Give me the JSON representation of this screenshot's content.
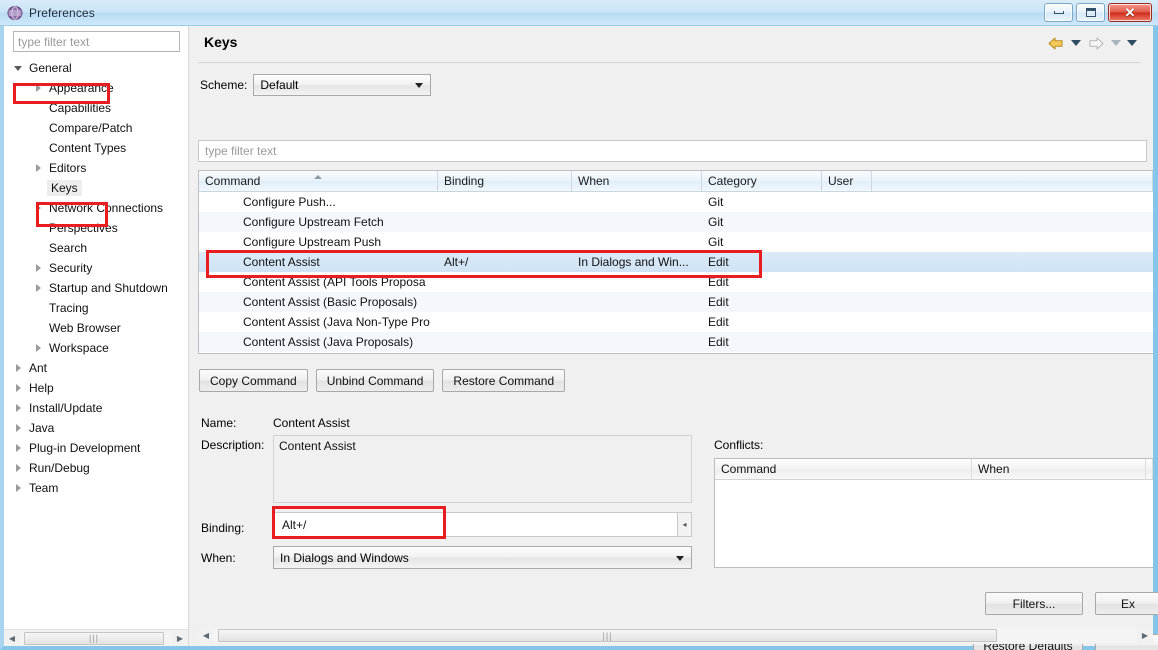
{
  "window": {
    "title": "Preferences",
    "icon": "preferences-icon",
    "buttons": {
      "minimize": "minimize-button",
      "maximize": "maximize-button",
      "close": "✕"
    }
  },
  "sidebar": {
    "filter_placeholder": "type filter text",
    "filter_value": "",
    "items": [
      {
        "label": "General",
        "indent": 0,
        "arrow": "expanded",
        "highlighted": true
      },
      {
        "label": "Appearance",
        "indent": 1,
        "arrow": "collapsed",
        "highlighted": false
      },
      {
        "label": "Capabilities",
        "indent": 1,
        "arrow": "none",
        "highlighted": false
      },
      {
        "label": "Compare/Patch",
        "indent": 1,
        "arrow": "none",
        "highlighted": false
      },
      {
        "label": "Content Types",
        "indent": 1,
        "arrow": "none",
        "highlighted": false
      },
      {
        "label": "Editors",
        "indent": 1,
        "arrow": "collapsed",
        "highlighted": false
      },
      {
        "label": "Keys",
        "indent": 1,
        "arrow": "none",
        "highlighted": true
      },
      {
        "label": "Network Connections",
        "indent": 1,
        "arrow": "collapsed",
        "highlighted": false
      },
      {
        "label": "Perspectives",
        "indent": 1,
        "arrow": "none",
        "highlighted": false
      },
      {
        "label": "Search",
        "indent": 1,
        "arrow": "none",
        "highlighted": false
      },
      {
        "label": "Security",
        "indent": 1,
        "arrow": "collapsed",
        "highlighted": false
      },
      {
        "label": "Startup and Shutdown",
        "indent": 1,
        "arrow": "collapsed",
        "highlighted": false
      },
      {
        "label": "Tracing",
        "indent": 1,
        "arrow": "none",
        "highlighted": false
      },
      {
        "label": "Web Browser",
        "indent": 1,
        "arrow": "none",
        "highlighted": false
      },
      {
        "label": "Workspace",
        "indent": 1,
        "arrow": "collapsed",
        "highlighted": false
      },
      {
        "label": "Ant",
        "indent": 0,
        "arrow": "collapsed",
        "highlighted": false
      },
      {
        "label": "Help",
        "indent": 0,
        "arrow": "collapsed",
        "highlighted": false
      },
      {
        "label": "Install/Update",
        "indent": 0,
        "arrow": "collapsed",
        "highlighted": false
      },
      {
        "label": "Java",
        "indent": 0,
        "arrow": "collapsed",
        "highlighted": false
      },
      {
        "label": "Plug-in Development",
        "indent": 0,
        "arrow": "collapsed",
        "highlighted": false
      },
      {
        "label": "Run/Debug",
        "indent": 0,
        "arrow": "collapsed",
        "highlighted": false
      },
      {
        "label": "Team",
        "indent": 0,
        "arrow": "collapsed",
        "highlighted": false
      }
    ]
  },
  "page": {
    "title": "Keys",
    "nav": {
      "back_icon": "back-arrow-icon",
      "back_menu_icon": "chevron-down-icon",
      "forward_icon": "forward-arrow-icon",
      "forward_menu_icon": "chevron-down-icon",
      "menu_icon": "chevron-down-icon"
    },
    "scheme": {
      "label": "Scheme:",
      "value": "Default"
    },
    "filter_placeholder": "type filter text",
    "filter_value": ""
  },
  "command_table": {
    "columns": [
      "Command",
      "Binding",
      "When",
      "Category",
      "User"
    ],
    "sorted_column": "Command",
    "rows": [
      {
        "command": "Configure Push...",
        "binding": "",
        "when": "",
        "category": "Git",
        "user": ""
      },
      {
        "command": "Configure Upstream Fetch",
        "binding": "",
        "when": "",
        "category": "Git",
        "user": ""
      },
      {
        "command": "Configure Upstream Push",
        "binding": "",
        "when": "",
        "category": "Git",
        "user": ""
      },
      {
        "command": "Content Assist",
        "binding": "Alt+/",
        "when": "In Dialogs and Win...",
        "category": "Edit",
        "user": ""
      },
      {
        "command": "Content Assist (API Tools Proposa",
        "binding": "",
        "when": "",
        "category": "Edit",
        "user": ""
      },
      {
        "command": "Content Assist (Basic Proposals)",
        "binding": "",
        "when": "",
        "category": "Edit",
        "user": ""
      },
      {
        "command": "Content Assist (Java Non-Type Pro",
        "binding": "",
        "when": "",
        "category": "Edit",
        "user": ""
      },
      {
        "command": "Content Assist (Java Proposals)",
        "binding": "",
        "when": "",
        "category": "Edit",
        "user": ""
      }
    ],
    "selected_row_index": 3
  },
  "command_buttons": [
    {
      "label": "Copy Command",
      "name": "copy-command-button"
    },
    {
      "label": "Unbind Command",
      "name": "unbind-command-button"
    },
    {
      "label": "Restore Command",
      "name": "restore-command-button"
    }
  ],
  "details": {
    "name_label": "Name:",
    "name_value": "Content Assist",
    "description_label": "Description:",
    "description_value": "Content Assist",
    "binding_label": "Binding:",
    "binding_value": "Alt+/",
    "when_label": "When:",
    "when_value": "In Dialogs and Windows"
  },
  "conflicts": {
    "label": "Conflicts:",
    "columns": [
      "Command",
      "When"
    ],
    "rows": []
  },
  "footer_buttons": {
    "filters": "Filters...",
    "export": "Ex",
    "restore_defaults": "Restore Defaults",
    "apply": ""
  },
  "colors": {
    "highlight_red": "#e81d20",
    "selection_blue": "#cfe3f5",
    "titlebar_blue": "#b9dcf4"
  }
}
